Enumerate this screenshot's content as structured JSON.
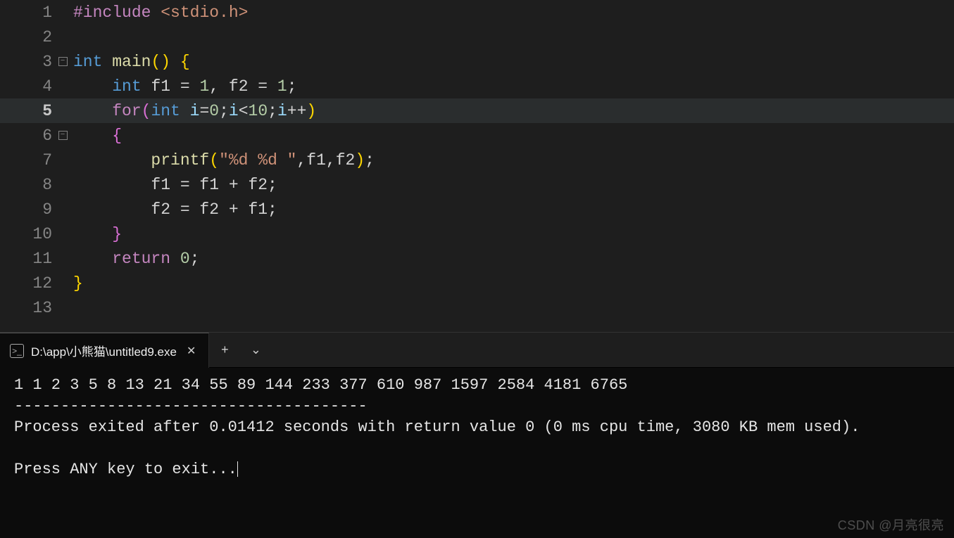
{
  "editor": {
    "highlighted_line": 5,
    "lines": [
      "1",
      "2",
      "3",
      "4",
      "5",
      "6",
      "7",
      "8",
      "9",
      "10",
      "11",
      "12",
      "13"
    ],
    "code": {
      "include_kw": "#include",
      "include_target": "<stdio.h>",
      "int": "int",
      "main": "main",
      "fn_paren": "()",
      "brace_open": "{",
      "brace_close": "}",
      "line4_a": "int",
      "line4_b": " f1 ",
      "line4_c": "=",
      "line4_d": " 1",
      "line4_e": ", f2 ",
      "line4_f": "=",
      "line4_g": " 1",
      "line4_h": ";",
      "for": "for",
      "l5_p1": "(",
      "l5_int": "int",
      "l5_a": " i",
      "l5_eq": "=",
      "l5_0": "0",
      "l5_sc1": ";",
      "l5_b": "i",
      "l5_lt": "<",
      "l5_10": "10",
      "l5_sc2": ";",
      "l5_c": "i",
      "l5_pp": "++",
      "l5_p2": ")",
      "l6_brace": "{",
      "printf": "printf",
      "l7_p1": "(",
      "l7_str": "\"%d %d \"",
      "l7_c1": ",f1,f2",
      "l7_p2": ")",
      "l7_sc": ";",
      "l8": "f1 = f1 + f2;",
      "l9": "f2 = f2 + f1;",
      "l10_brace": "}",
      "return": "return",
      "ret0": " 0",
      "ret_sc": ";"
    }
  },
  "terminal": {
    "tab_title": "D:\\app\\小熊猫\\untitled9.exe",
    "new_tab": "+",
    "dropdown": "⌄",
    "output_line1": "1 1 2 3 5 8 13 21 34 55 89 144 233 377 610 987 1597 2584 4181 6765",
    "separator": "--------------------------------------",
    "output_line2": "Process exited after 0.01412 seconds with return value 0 (0 ms cpu time, 3080 KB mem used).",
    "blank": "",
    "prompt": "Press ANY key to exit..."
  },
  "watermark": "CSDN @月亮很亮"
}
